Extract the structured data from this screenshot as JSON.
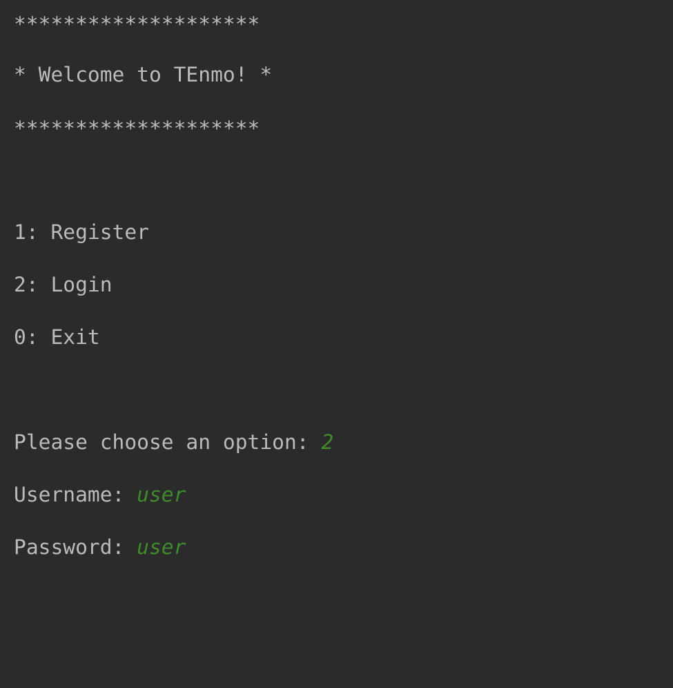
{
  "console": {
    "banner_top": "********************",
    "welcome": "* Welcome to TEnmo! *",
    "banner_bottom": "********************",
    "menu": [
      {
        "key": "1",
        "label": "1: Register"
      },
      {
        "key": "2",
        "label": "2: Login"
      },
      {
        "key": "0",
        "label": "0: Exit"
      }
    ],
    "prompt_option": {
      "label": "Please choose an option: ",
      "input": "2"
    },
    "prompt_username": {
      "label": "Username: ",
      "input": "user"
    },
    "prompt_password": {
      "label": "Password: ",
      "input": "user"
    },
    "colors": {
      "background": "#2b2b2b",
      "output_text": "#bbbbbb",
      "user_input": "#3e8b2b"
    }
  }
}
